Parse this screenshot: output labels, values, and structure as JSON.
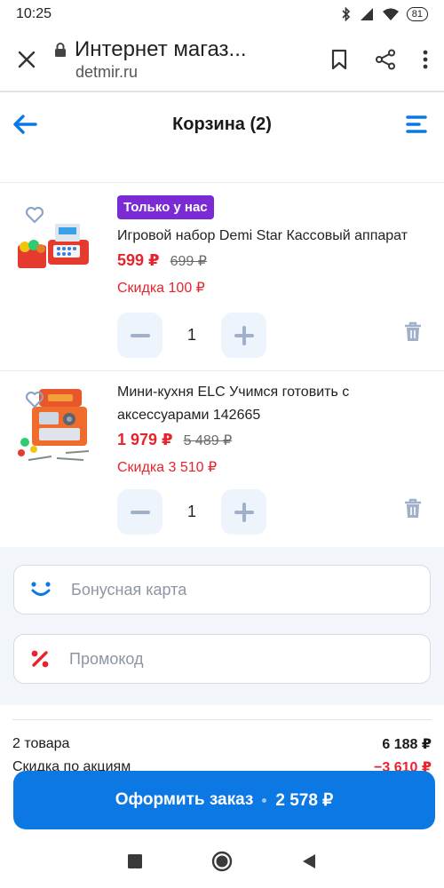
{
  "status_bar": {
    "time": "10:25",
    "battery": "81",
    "icons": [
      "bluetooth-icon",
      "signal-icon",
      "wifi-icon",
      "battery-icon"
    ]
  },
  "browser": {
    "title": "Интернет магаз...",
    "url": "detmir.ru",
    "icons": [
      "close-icon",
      "lock-icon",
      "bookmark-icon",
      "share-icon",
      "more-icon"
    ]
  },
  "header": {
    "title": "Корзина (2)",
    "icons": [
      "back-arrow-icon",
      "menu-icon"
    ]
  },
  "items": [
    {
      "badge": "Только у нас",
      "name": "Игровой набор Demi Star Кассовый аппарат",
      "price": "599 ₽",
      "old_price": "699 ₽",
      "discount": "Скидка 100 ₽",
      "qty": "1"
    },
    {
      "badge": "",
      "name": "Мини-кухня ELC Учимся готовить с аксессуарами 142665",
      "price": "1 979 ₽",
      "old_price": "5 489 ₽",
      "discount": "Скидка 3 510 ₽",
      "qty": "1"
    }
  ],
  "fields": {
    "bonus_placeholder": "Бонусная карта",
    "promo_placeholder": "Промокод"
  },
  "summary": {
    "goods_label": "2 товара",
    "goods_value": "6 188 ₽",
    "discount_label": "Скидка по акциям",
    "discount_value": "−3 610 ₽"
  },
  "order_button": {
    "label": "Оформить заказ",
    "total": "2 578 ₽"
  },
  "colors": {
    "accent": "#0c78e3",
    "price_red": "#e8232d",
    "badge_purple": "#7b2bd4"
  }
}
